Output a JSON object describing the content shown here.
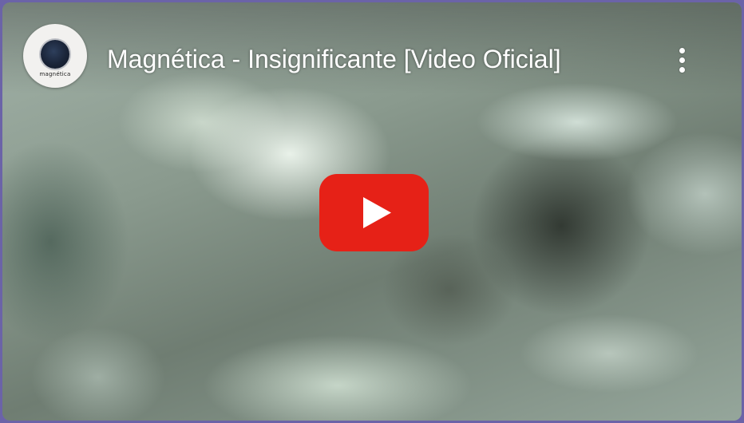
{
  "video": {
    "title": "Magnética - Insignificante [Video Oficial]",
    "channel_avatar_text": "magnética",
    "channel_avatar_icon": "channel-logo",
    "menu_icon": "more-vert-icon",
    "play_icon": "youtube-play-icon"
  },
  "colors": {
    "play_button": "#e62117",
    "play_glyph": "#ffffff",
    "title_text": "#ffffff",
    "page_border": "#6b63a8"
  }
}
